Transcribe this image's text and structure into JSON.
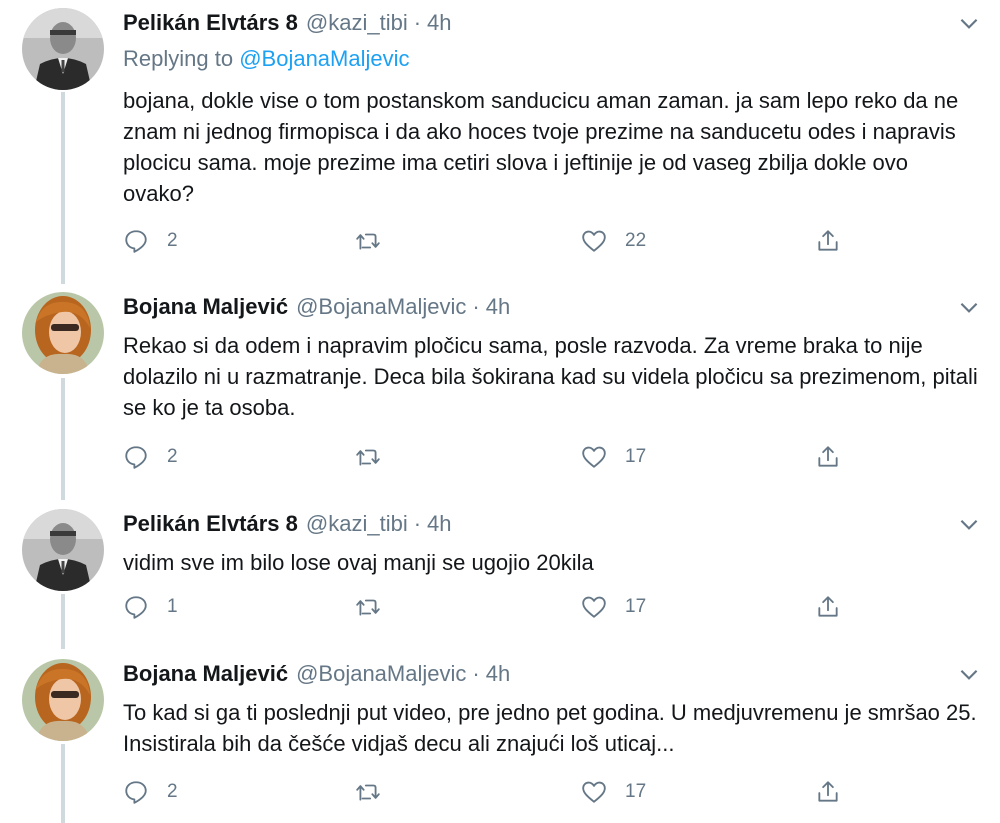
{
  "tweets": [
    {
      "author": "Pelikán Elvtárs 8",
      "handle": "@kazi_tibi",
      "separator": "·",
      "time": "4h",
      "replying_prefix": "Replying to",
      "replying_to": "@BojanaMaljevic",
      "text": "bojana, dokle vise o tom postanskom sanducicu aman zaman. ja sam lepo reko da ne znam ni jednog firmopisca i da ako hoces tvoje prezime na sanducetu odes i napravis plocicu sama. moje prezime ima cetiri slova i jeftinije je od vaseg zbilja dokle ovo ovako?",
      "replies": "2",
      "likes": "22"
    },
    {
      "author": "Bojana Maljević",
      "handle": "@BojanaMaljevic",
      "separator": "·",
      "time": "4h",
      "text": "Rekao si da odem i napravim pločicu sama, posle razvoda. Za vreme braka to nije dolazilo ni u razmatranje. Deca bila šokirana kad su videla pločicu sa prezimenom, pitali se ko je ta osoba.",
      "replies": "2",
      "likes": "17"
    },
    {
      "author": "Pelikán Elvtárs 8",
      "handle": "@kazi_tibi",
      "separator": "·",
      "time": "4h",
      "text": "vidim sve im bilo lose ovaj manji se ugojio 20kila",
      "replies": "1",
      "likes": "17"
    },
    {
      "author": "Bojana Maljević",
      "handle": "@BojanaMaljevic",
      "separator": "·",
      "time": "4h",
      "text": "To kad si ga ti poslednji put video, pre jedno pet godina. U medjuvremenu je smršao 25. Insistirala bih da češće vidjaš decu ali znajući loš uticaj...",
      "replies": "2",
      "likes": "17"
    }
  ],
  "icons": {
    "reply": "reply-icon",
    "retweet": "retweet-icon",
    "like": "like-icon",
    "share": "share-icon",
    "caret": "chevron-down-icon"
  },
  "colors": {
    "text": "#14171a",
    "secondary": "#657786",
    "link": "#1da1f2",
    "thread_line": "#cfd9de"
  }
}
